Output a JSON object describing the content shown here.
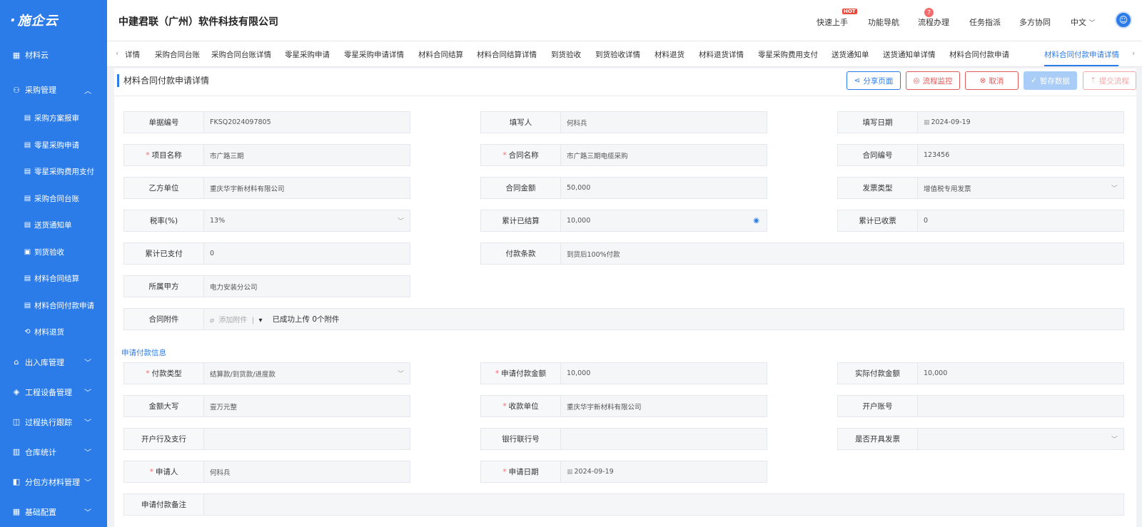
{
  "sidebar": {
    "logo": "施企云",
    "home": "材料云",
    "purchase_mgmt": "采购管理",
    "sub_items": [
      "采购方案报审",
      "零星采购申请",
      "零星采购费用支付",
      "采购合同台账",
      "送货通知单",
      "到货验收",
      "材料合同结算",
      "材料合同付款申请",
      "材料退货"
    ],
    "groups": [
      "出入库管理",
      "工程设备管理",
      "过程执行跟踪",
      "仓库统计",
      "分包方材料管理",
      "基础配置"
    ]
  },
  "topbar": {
    "company": "中建君联（广州）软件科技有限公司",
    "quick_start": "快速上手",
    "hot": "HOT",
    "func_nav": "功能导航",
    "flow": "流程办理",
    "flow_badge": "7",
    "task": "任务指派",
    "collab": "多方协同",
    "lang": "中文"
  },
  "tabs": [
    "详情",
    "采购合同台账",
    "采购合同台账详情",
    "零星采购申请",
    "零星采购申请详情",
    "材料合同结算",
    "材料合同结算详情",
    "到货验收",
    "到货验收详情",
    "材料退货",
    "材料退货详情",
    "零星采购费用支付",
    "送货通知单",
    "送货通知单详情",
    "材料合同付款申请",
    "材料合同付款申请详情"
  ],
  "page": {
    "title": "材料合同付款申请详情",
    "btn_share": "分享页面",
    "btn_monitor": "流程监控",
    "btn_cancel": "取消",
    "btn_save": "暂存数据",
    "btn_submit": "提交流程",
    "section_title": "申请付款信息"
  },
  "form": {
    "doc_no": {
      "label": "单据编号",
      "value": "FKSQ2024097805"
    },
    "filler": {
      "label": "填写人",
      "value": "何科兵"
    },
    "fill_date": {
      "label": "填写日期",
      "value": "2024-09-19"
    },
    "project_name": {
      "label": "项目名称",
      "value": "市广路三期"
    },
    "contract_name": {
      "label": "合同名称",
      "value": "市广路三期电缆采购"
    },
    "contract_no": {
      "label": "合同编号",
      "value": "123456"
    },
    "party_b": {
      "label": "乙方单位",
      "value": "重庆华宇新材料有限公司"
    },
    "contract_amount": {
      "label": "合同金额",
      "value": "50,000"
    },
    "invoice_type": {
      "label": "发票类型",
      "value": "增值税专用发票"
    },
    "tax_rate": {
      "label": "税率(%)",
      "value": "13%"
    },
    "settled": {
      "label": "累计已结算",
      "value": "10,000"
    },
    "received": {
      "label": "累计已收票",
      "value": "0"
    },
    "paid": {
      "label": "累计已支付",
      "value": "0"
    },
    "pay_terms": {
      "label": "付款条款",
      "value": "到货后100%付款"
    },
    "party_a": {
      "label": "所属甲方",
      "value": "电力安装分公司"
    },
    "attachment": {
      "label": "合同附件",
      "add": "添加附件",
      "status": "已成功上传 0个附件"
    },
    "pay_type": {
      "label": "付款类型",
      "value": "结算款/到货款/进度款"
    },
    "apply_amount": {
      "label": "申请付款金额",
      "value": "10,000"
    },
    "actual_amount": {
      "label": "实际付款金额",
      "value": "10,000"
    },
    "amount_upper": {
      "label": "金额大写",
      "value": "壹万元整"
    },
    "payee": {
      "label": "收款单位",
      "value": "重庆华宇新材料有限公司"
    },
    "account": {
      "label": "开户账号",
      "value": ""
    },
    "bank": {
      "label": "开户行及支行",
      "value": ""
    },
    "bank_no": {
      "label": "银行联行号",
      "value": ""
    },
    "invoice_issued": {
      "label": "是否开具发票",
      "value": ""
    },
    "applicant": {
      "label": "申请人",
      "value": "何科兵"
    },
    "apply_date": {
      "label": "申请日期",
      "value": "2024-09-19"
    },
    "remark": {
      "label": "申请付款备注",
      "value": ""
    }
  }
}
